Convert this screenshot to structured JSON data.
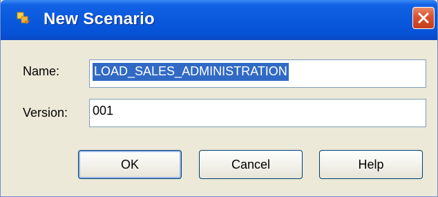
{
  "window": {
    "title": "New Scenario",
    "icon": "scenario-icon",
    "close_icon": "close-icon"
  },
  "form": {
    "name_label": "Name:",
    "name_value": "LOAD_SALES_ADMINISTRATION",
    "version_label": "Version:",
    "version_value": "001"
  },
  "buttons": {
    "ok": "OK",
    "cancel": "Cancel",
    "help": "Help"
  },
  "colors": {
    "titlebar": "#0a58dc",
    "selection": "#316ac5",
    "close": "#d8502d"
  }
}
